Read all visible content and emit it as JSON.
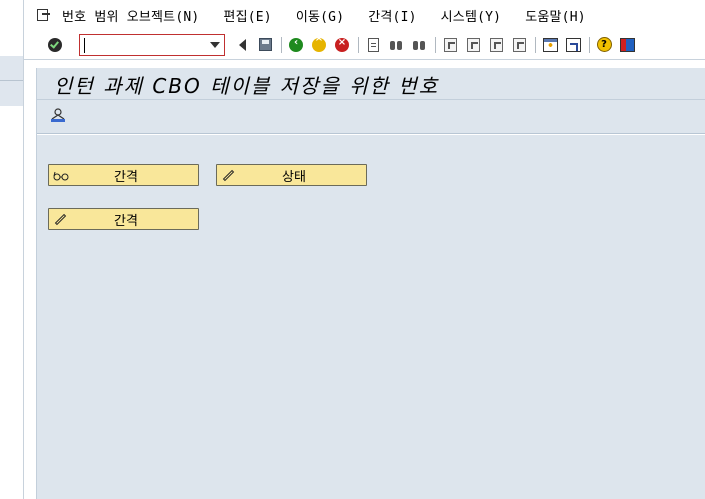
{
  "menu": {
    "items": [
      "번호 범위 오브젝트(N)",
      "편집(E)",
      "이동(G)",
      "간격(I)",
      "시스템(Y)",
      "도움말(H)"
    ]
  },
  "toolbar": {
    "command_field_value": ""
  },
  "title": "인턴 과제 CBO 테이블 저장을 위한 번호",
  "buttons": {
    "intervals_display": "간격",
    "status": "상태",
    "intervals_change": "간격"
  }
}
